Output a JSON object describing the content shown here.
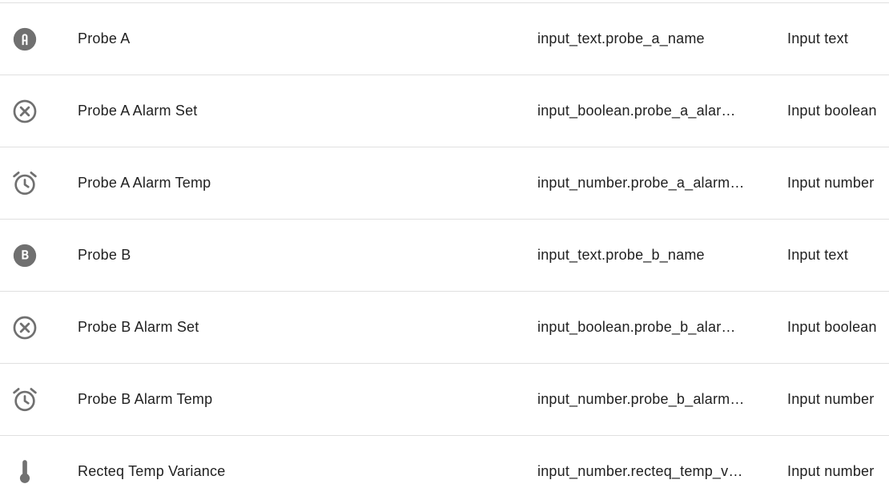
{
  "colors": {
    "icon": "#707070",
    "text": "#212121",
    "divider": "#e0e0e0"
  },
  "rows": [
    {
      "icon": "alpha-a-circle-icon",
      "name": "Probe A",
      "entity_id": "input_text.probe_a_name",
      "domain": "Input text"
    },
    {
      "icon": "close-circle-outline-icon",
      "name": "Probe A Alarm Set",
      "entity_id": "input_boolean.probe_a_alarm…",
      "domain": "Input boolean"
    },
    {
      "icon": "alarm-icon",
      "name": "Probe A Alarm Temp",
      "entity_id": "input_number.probe_a_alarm…",
      "domain": "Input number"
    },
    {
      "icon": "alpha-b-circle-icon",
      "name": "Probe B",
      "entity_id": "input_text.probe_b_name",
      "domain": "Input text"
    },
    {
      "icon": "close-circle-outline-icon",
      "name": "Probe B Alarm Set",
      "entity_id": "input_boolean.probe_b_alarm…",
      "domain": "Input boolean"
    },
    {
      "icon": "alarm-icon",
      "name": "Probe B Alarm Temp",
      "entity_id": "input_number.probe_b_alarm…",
      "domain": "Input number"
    },
    {
      "icon": "thermometer-icon",
      "name": "Recteq Temp Variance",
      "entity_id": "input_number.recteq_temp_v…",
      "domain": "Input number"
    }
  ]
}
